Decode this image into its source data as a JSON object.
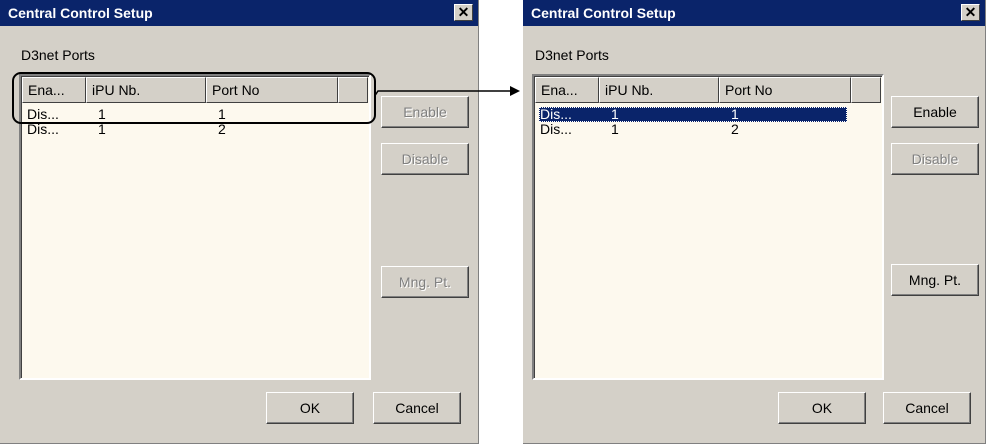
{
  "dialogs": [
    {
      "title": "Central Control Setup",
      "close_glyph": "✕",
      "group_label": "D3net Ports",
      "columns": [
        "Ena...",
        "iPU Nb.",
        "Port No",
        ""
      ],
      "rows": [
        {
          "enabled": "Dis...",
          "ipu": "1",
          "port": "1"
        },
        {
          "enabled": "Dis...",
          "ipu": "1",
          "port": "2"
        }
      ],
      "buttons": {
        "enable": "Enable",
        "disable": "Disable",
        "mng": "Mng. Pt.",
        "ok": "OK",
        "cancel": "Cancel"
      },
      "button_state": {
        "enable": "disabled",
        "disable": "disabled",
        "mng": "disabled"
      }
    },
    {
      "title": "Central Control Setup",
      "close_glyph": "✕",
      "group_label": "D3net Ports",
      "columns": [
        "Ena...",
        "iPU Nb.",
        "Port No",
        ""
      ],
      "rows": [
        {
          "enabled": "Dis...",
          "ipu": "1",
          "port": "1",
          "selected": true
        },
        {
          "enabled": "Dis...",
          "ipu": "1",
          "port": "2"
        }
      ],
      "buttons": {
        "enable": "Enable",
        "disable": "Disable",
        "mng": "Mng. Pt.",
        "ok": "OK",
        "cancel": "Cancel"
      },
      "button_state": {
        "enable": "enabled",
        "disable": "disabled",
        "mng": "enabled"
      }
    }
  ],
  "annotation": {
    "arrow_color": "#000000"
  }
}
